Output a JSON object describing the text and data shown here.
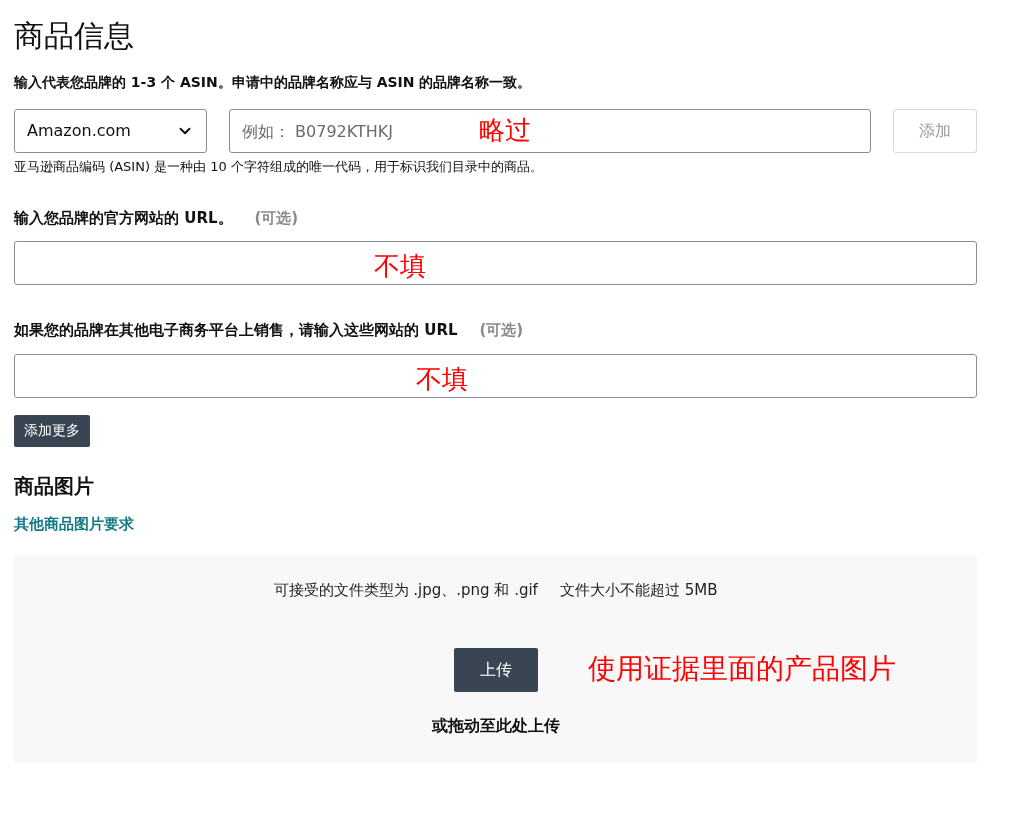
{
  "title": "商品信息",
  "asin": {
    "label": "输入代表您品牌的 1-3 个 ASIN。申请中的品牌名称应与 ASIN 的品牌名称一致。",
    "marketplace": "Amazon.com",
    "placeholder": "例如： B0792KTHKJ",
    "note": "略过",
    "add_button": {
      "label": "添加",
      "disabled": true
    },
    "help": "亚马逊商品编码 (ASIN) 是一种由 10 个字符组成的唯一代码，用于标识我们目录中的商品。"
  },
  "url_fields": [
    {
      "label": "输入您品牌的官方网站的 URL。",
      "optional": "(可选)",
      "note": "不填"
    },
    {
      "label": "如果您的品牌在其他电子商务平台上销售，请输入这些网站的 URL",
      "optional": "(可选)",
      "note": "不填"
    }
  ],
  "add_more_button": "添加更多",
  "images": {
    "heading": "商品图片",
    "link": "其他商品图片要求",
    "file_info": "可接受的文件类型为 .jpg、.png 和 .gif",
    "size_info": "文件大小不能超过 5MB",
    "upload_button": "上传",
    "note": "使用证据里面的产品图片",
    "drag_text": "或拖动至此处上传"
  }
}
